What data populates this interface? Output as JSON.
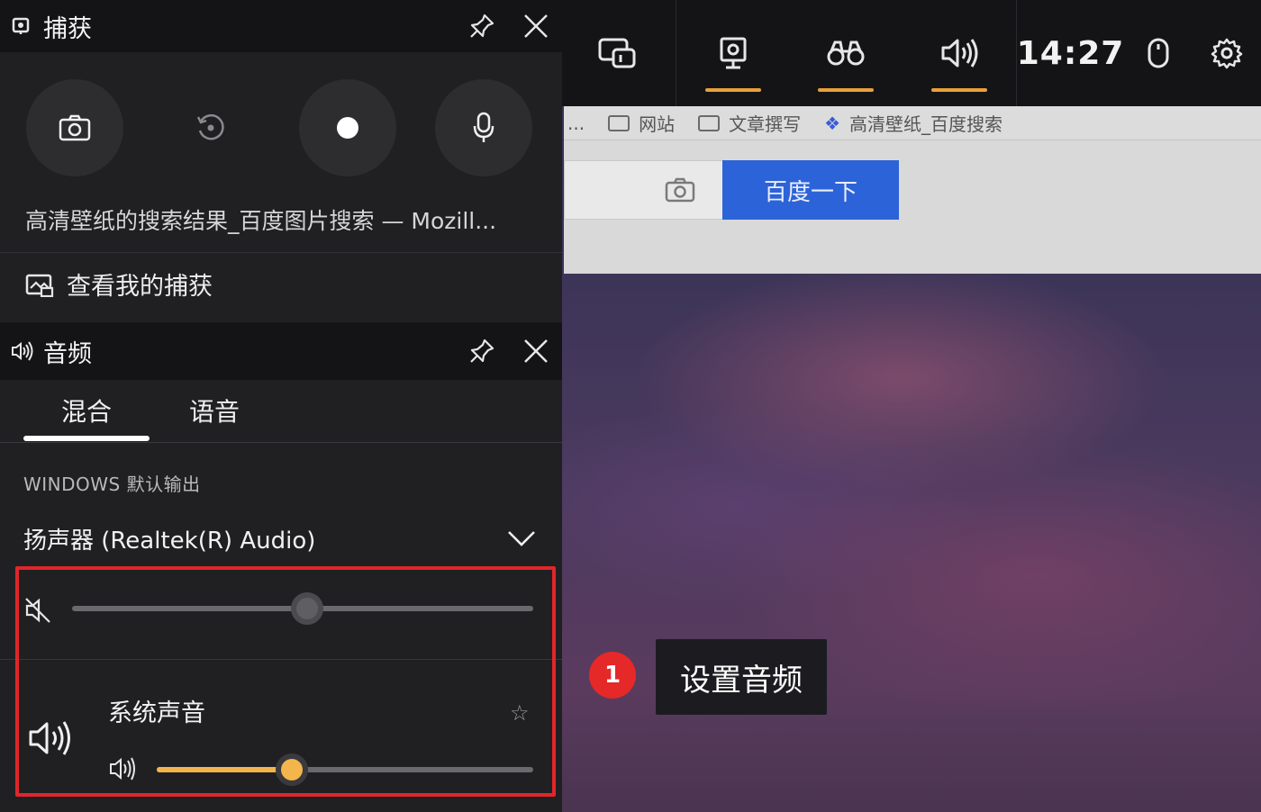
{
  "topbar": {
    "time": "14:27",
    "widgets": [
      {
        "name": "widget-menu",
        "active": false
      },
      {
        "name": "capture",
        "active": true
      },
      {
        "name": "looking-for-group",
        "active": true
      },
      {
        "name": "audio",
        "active": true
      }
    ],
    "accent_color": "#e8a03a"
  },
  "capture_panel": {
    "title": "捕获",
    "window_title": "高清壁纸的搜索结果_百度图片搜索 — Mozill...",
    "view_captures_label": "查看我的捕获"
  },
  "audio_panel": {
    "title": "音频",
    "tabs": [
      {
        "label": "混合",
        "selected": true
      },
      {
        "label": "语音",
        "selected": false
      }
    ],
    "section_label": "WINDOWS 默认输出",
    "device": "扬声器 (Realtek(R) Audio)",
    "master_volume": 0.51,
    "master_muted": true,
    "apps": [
      {
        "name": "系统声音",
        "volume": 0.36,
        "favorite": false
      }
    ]
  },
  "browser": {
    "bookmarks": [
      "...",
      "网站",
      "文章撰写",
      "高清壁纸_百度搜索"
    ],
    "search_button": "百度一下"
  },
  "callout": {
    "number": "1",
    "text": "设置音频",
    "color": "#e52828"
  }
}
